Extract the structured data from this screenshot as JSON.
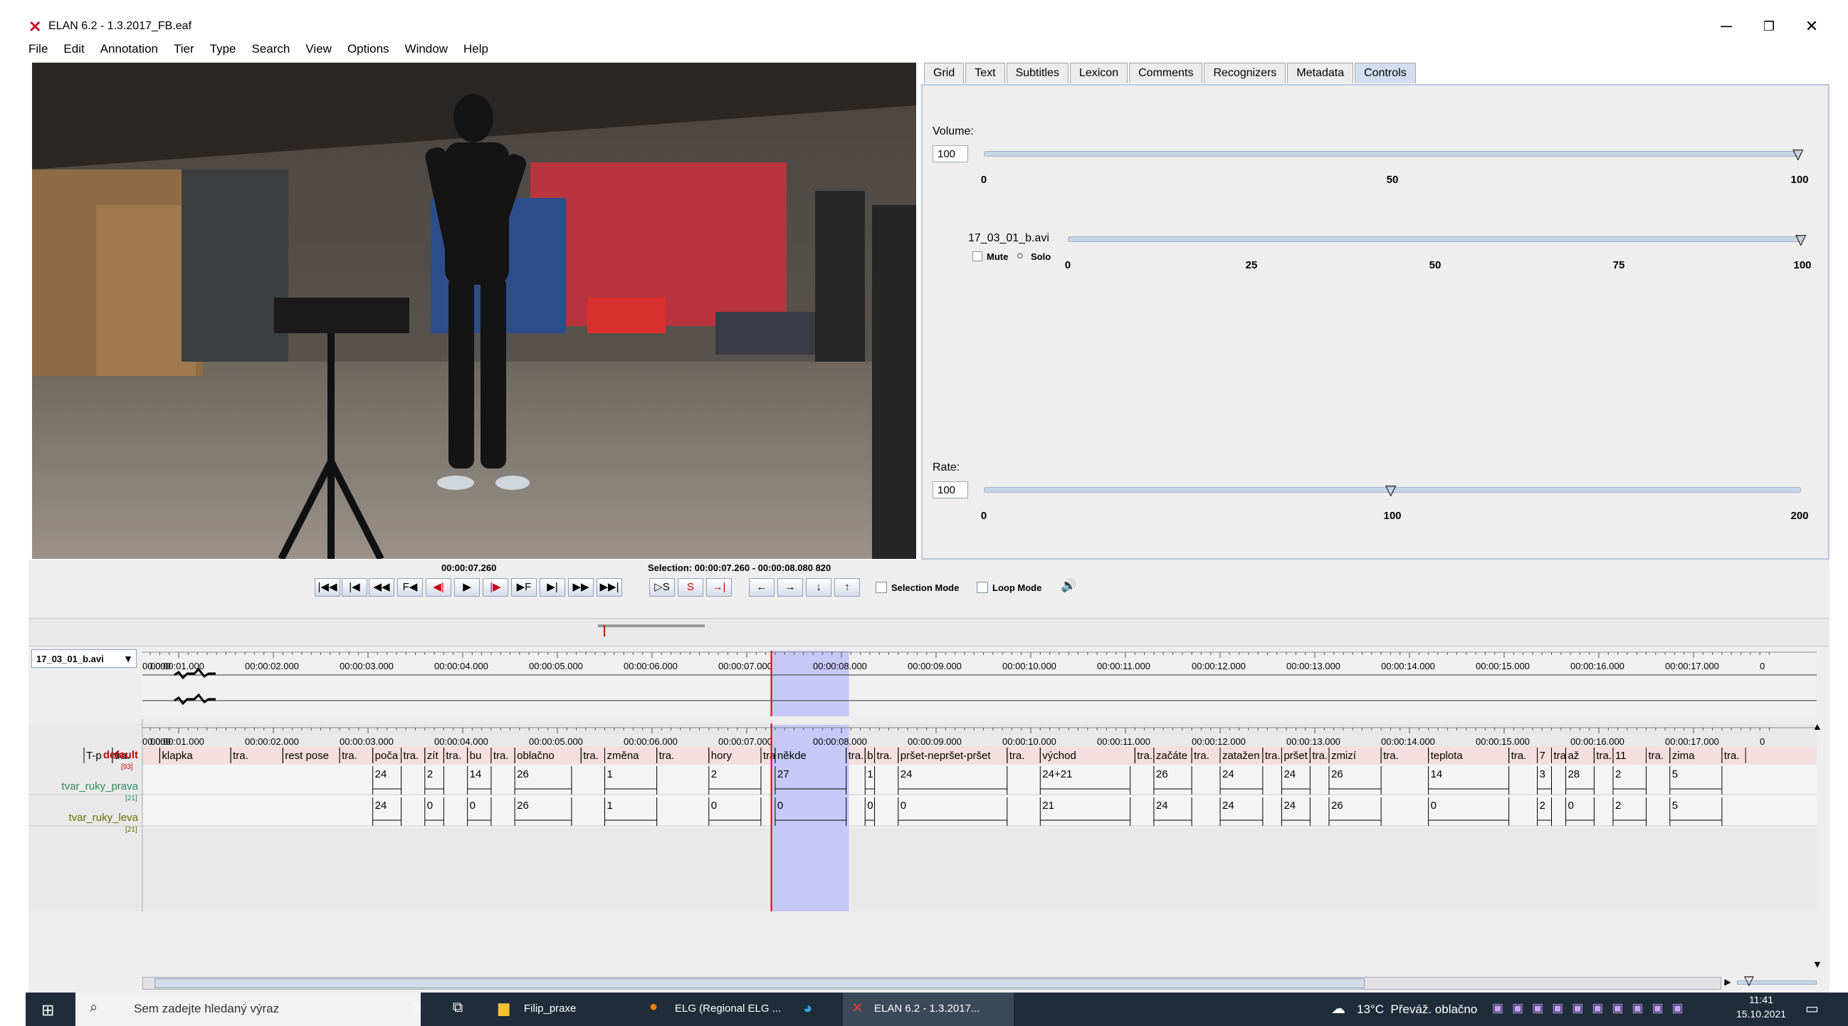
{
  "window": {
    "title": "ELAN 6.2 - 1.3.2017_FB.eaf",
    "minimize": "─",
    "restore": "❐",
    "close": "✕"
  },
  "menu": [
    "File",
    "Edit",
    "Annotation",
    "Tier",
    "Type",
    "Search",
    "View",
    "Options",
    "Window",
    "Help"
  ],
  "tabs": [
    "Grid",
    "Text",
    "Subtitles",
    "Lexicon",
    "Comments",
    "Recognizers",
    "Metadata",
    "Controls"
  ],
  "active_tab": "Controls",
  "controls": {
    "volume": {
      "label": "Volume:",
      "value": "100",
      "ticks": [
        "0",
        "50",
        "100"
      ],
      "level": 100
    },
    "media": {
      "label": "17_03_01_b.avi",
      "mute": "Mute",
      "solo": "Solo",
      "ticks": [
        "0",
        "25",
        "50",
        "75",
        "100"
      ],
      "level": 100
    },
    "rate": {
      "label": "Rate:",
      "value": "100",
      "ticks": [
        "0",
        "100",
        "200"
      ],
      "level": 100
    }
  },
  "player": {
    "current_time": "00:00:07.260",
    "selection": "Selection: 00:00:07.260 - 00:00:08.080  820",
    "selection_mode": "Selection Mode",
    "loop_mode": "Loop Mode",
    "buttons": [
      "|◀◀",
      "|◀",
      "◀◀",
      "F◀",
      "◀|",
      "▶",
      "|▶",
      "▶F",
      "▶|",
      "▶▶",
      "▶▶|"
    ],
    "sel_buttons": [
      "▷S",
      "S",
      "→|"
    ],
    "nav_buttons": [
      "←",
      "→",
      "↓",
      "↑"
    ]
  },
  "media_selector": "17_03_01_b.avi",
  "ruler_labels": [
    "00.000",
    "00:00:01.000",
    "00:00:02.000",
    "00:00:03.000",
    "00:00:04.000",
    "00:00:05.000",
    "00:00:06.000",
    "00:00:07.000",
    "00:00:08.000",
    "00:00:09.000",
    "00:00:10.000",
    "00:00:11.000",
    "00:00:12.000",
    "00:00:13.000",
    "00:00:14.000",
    "00:00:15.000",
    "00:00:16.000",
    "00:00:17.000",
    "0"
  ],
  "tiers": [
    {
      "name": "default",
      "count": "[93]",
      "color": "#cc0000",
      "annotations": [
        {
          "t": "T-p",
          "s": 0.0,
          "e": 0.3
        },
        {
          "t": "tra.",
          "s": 0.3,
          "e": 0.8
        },
        {
          "t": "klapka",
          "s": 0.8,
          "e": 1.55
        },
        {
          "t": "tra.",
          "s": 1.55,
          "e": 2.1
        },
        {
          "t": "rest pose",
          "s": 2.1,
          "e": 2.7
        },
        {
          "t": "tra.",
          "s": 2.7,
          "e": 3.05
        },
        {
          "t": "poča",
          "s": 3.05,
          "e": 3.35
        },
        {
          "t": "tra.",
          "s": 3.35,
          "e": 3.6
        },
        {
          "t": "zít",
          "s": 3.6,
          "e": 3.8
        },
        {
          "t": "tra.",
          "s": 3.8,
          "e": 4.05
        },
        {
          "t": "bu",
          "s": 4.05,
          "e": 4.3
        },
        {
          "t": "tra.",
          "s": 4.3,
          "e": 4.55
        },
        {
          "t": "oblačno",
          "s": 4.55,
          "e": 5.25
        },
        {
          "t": "tra.",
          "s": 5.25,
          "e": 5.5
        },
        {
          "t": "změna",
          "s": 5.5,
          "e": 6.05
        },
        {
          "t": "tra.",
          "s": 6.05,
          "e": 6.6
        },
        {
          "t": "hory",
          "s": 6.6,
          "e": 7.15
        },
        {
          "t": "tra",
          "s": 7.15,
          "e": 7.3
        },
        {
          "t": "někde",
          "s": 7.3,
          "e": 8.05
        },
        {
          "t": "tra.",
          "s": 8.05,
          "e": 8.25
        },
        {
          "t": "b",
          "s": 8.25,
          "e": 8.35
        },
        {
          "t": "tra.",
          "s": 8.35,
          "e": 8.6
        },
        {
          "t": "pršet-nepršet-pršet",
          "s": 8.6,
          "e": 9.75
        },
        {
          "t": "tra.",
          "s": 9.75,
          "e": 10.1
        },
        {
          "t": "východ",
          "s": 10.1,
          "e": 11.1
        },
        {
          "t": "tra.",
          "s": 11.1,
          "e": 11.3
        },
        {
          "t": "začáte",
          "s": 11.3,
          "e": 11.7
        },
        {
          "t": "tra.",
          "s": 11.7,
          "e": 12.0
        },
        {
          "t": "zatažen",
          "s": 12.0,
          "e": 12.45
        },
        {
          "t": "tra.",
          "s": 12.45,
          "e": 12.65
        },
        {
          "t": "pršet",
          "s": 12.65,
          "e": 12.95
        },
        {
          "t": "tra.",
          "s": 12.95,
          "e": 13.15
        },
        {
          "t": "zmizí",
          "s": 13.15,
          "e": 13.7
        },
        {
          "t": "tra.",
          "s": 13.7,
          "e": 14.2
        },
        {
          "t": "teplota",
          "s": 14.2,
          "e": 15.05
        },
        {
          "t": "tra.",
          "s": 15.05,
          "e": 15.35
        },
        {
          "t": "7",
          "s": 15.35,
          "e": 15.5
        },
        {
          "t": "tra",
          "s": 15.5,
          "e": 15.65
        },
        {
          "t": "až",
          "s": 15.65,
          "e": 15.95
        },
        {
          "t": "tra.",
          "s": 15.95,
          "e": 16.15
        },
        {
          "t": "11",
          "s": 16.15,
          "e": 16.5
        },
        {
          "t": "tra.",
          "s": 16.5,
          "e": 16.75
        },
        {
          "t": "zima",
          "s": 16.75,
          "e": 17.3
        },
        {
          "t": "tra.",
          "s": 17.3,
          "e": 17.55
        }
      ]
    },
    {
      "name": "tvar_ruky_prava",
      "count": "[21]",
      "color": "#2e8b57",
      "annotations": [
        {
          "t": "24",
          "s": 3.05,
          "e": 3.35
        },
        {
          "t": "2",
          "s": 3.6,
          "e": 3.8
        },
        {
          "t": "14",
          "s": 4.05,
          "e": 4.3
        },
        {
          "t": "26",
          "s": 4.55,
          "e": 5.15
        },
        {
          "t": "1",
          "s": 5.5,
          "e": 6.05
        },
        {
          "t": "2",
          "s": 6.6,
          "e": 7.15
        },
        {
          "t": "27",
          "s": 7.3,
          "e": 8.05
        },
        {
          "t": "1",
          "s": 8.25,
          "e": 8.35
        },
        {
          "t": "24",
          "s": 8.6,
          "e": 9.75
        },
        {
          "t": "24+21",
          "s": 10.1,
          "e": 11.05
        },
        {
          "t": "26",
          "s": 11.3,
          "e": 11.7
        },
        {
          "t": "24",
          "s": 12.0,
          "e": 12.45
        },
        {
          "t": "24",
          "s": 12.65,
          "e": 12.95
        },
        {
          "t": "26",
          "s": 13.15,
          "e": 13.7
        },
        {
          "t": "14",
          "s": 14.2,
          "e": 15.05
        },
        {
          "t": "3",
          "s": 15.35,
          "e": 15.5
        },
        {
          "t": "28",
          "s": 15.65,
          "e": 15.95
        },
        {
          "t": "2",
          "s": 16.15,
          "e": 16.5
        },
        {
          "t": "5",
          "s": 16.75,
          "e": 17.3
        }
      ]
    },
    {
      "name": "tvar_ruky_leva",
      "count": "[21]",
      "color": "#6b6b00",
      "annotations": [
        {
          "t": "24",
          "s": 3.05,
          "e": 3.35
        },
        {
          "t": "0",
          "s": 3.6,
          "e": 3.8
        },
        {
          "t": "0",
          "s": 4.05,
          "e": 4.3
        },
        {
          "t": "26",
          "s": 4.55,
          "e": 5.15
        },
        {
          "t": "1",
          "s": 5.5,
          "e": 6.05
        },
        {
          "t": "0",
          "s": 6.6,
          "e": 7.15
        },
        {
          "t": "0",
          "s": 7.3,
          "e": 8.05
        },
        {
          "t": "0",
          "s": 8.25,
          "e": 8.35
        },
        {
          "t": "0",
          "s": 8.6,
          "e": 9.75
        },
        {
          "t": "21",
          "s": 10.1,
          "e": 11.05
        },
        {
          "t": "24",
          "s": 11.3,
          "e": 11.7
        },
        {
          "t": "24",
          "s": 12.0,
          "e": 12.45
        },
        {
          "t": "24",
          "s": 12.65,
          "e": 12.95
        },
        {
          "t": "26",
          "s": 13.15,
          "e": 13.7
        },
        {
          "t": "0",
          "s": 14.2,
          "e": 15.05
        },
        {
          "t": "2",
          "s": 15.35,
          "e": 15.5
        },
        {
          "t": "0",
          "s": 15.65,
          "e": 15.95
        },
        {
          "t": "2",
          "s": 16.15,
          "e": 16.5
        },
        {
          "t": "5",
          "s": 16.75,
          "e": 17.3
        }
      ]
    }
  ],
  "time": {
    "crosshair": 7.26,
    "sel_start": 7.26,
    "sel_end": 8.08
  },
  "taskbar": {
    "search_placeholder": "Sem zadejte hledaný výraz",
    "apps": [
      "Filip_praxe",
      "ELG (Regional ELG ...",
      "",
      "ELAN 6.2 - 1.3.2017..."
    ],
    "weather": "13°C  Převáž. oblačno",
    "time": "11:41",
    "date": "15.10.2021"
  }
}
